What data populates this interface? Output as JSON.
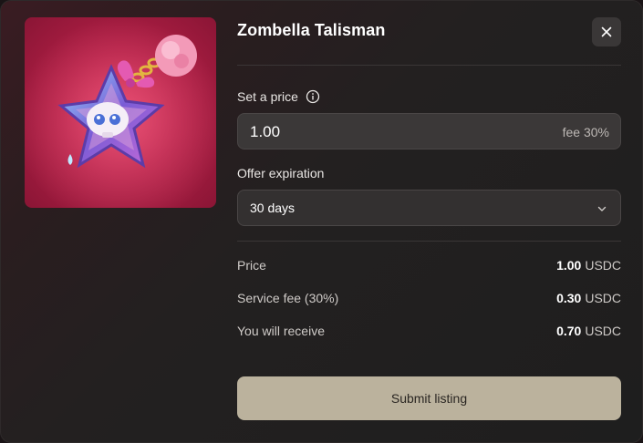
{
  "item": {
    "title": "Zombella Talisman",
    "image_icon": "star-skull-talisman"
  },
  "close_icon": "close-icon",
  "price": {
    "label": "Set a price",
    "value": "1.00",
    "fee_label": "fee 30%"
  },
  "expiration": {
    "label": "Offer expiration",
    "selected": "30 days"
  },
  "summary": {
    "currency": "USDC",
    "rows": [
      {
        "label": "Price",
        "amount": "1.00"
      },
      {
        "label": "Service fee (30%)",
        "amount": "0.30"
      },
      {
        "label": "You will receive",
        "amount": "0.70"
      }
    ]
  },
  "submit_label": "Submit listing",
  "colors": {
    "submit_bg": "#bbb29d",
    "art_bg": "#b01f45"
  }
}
